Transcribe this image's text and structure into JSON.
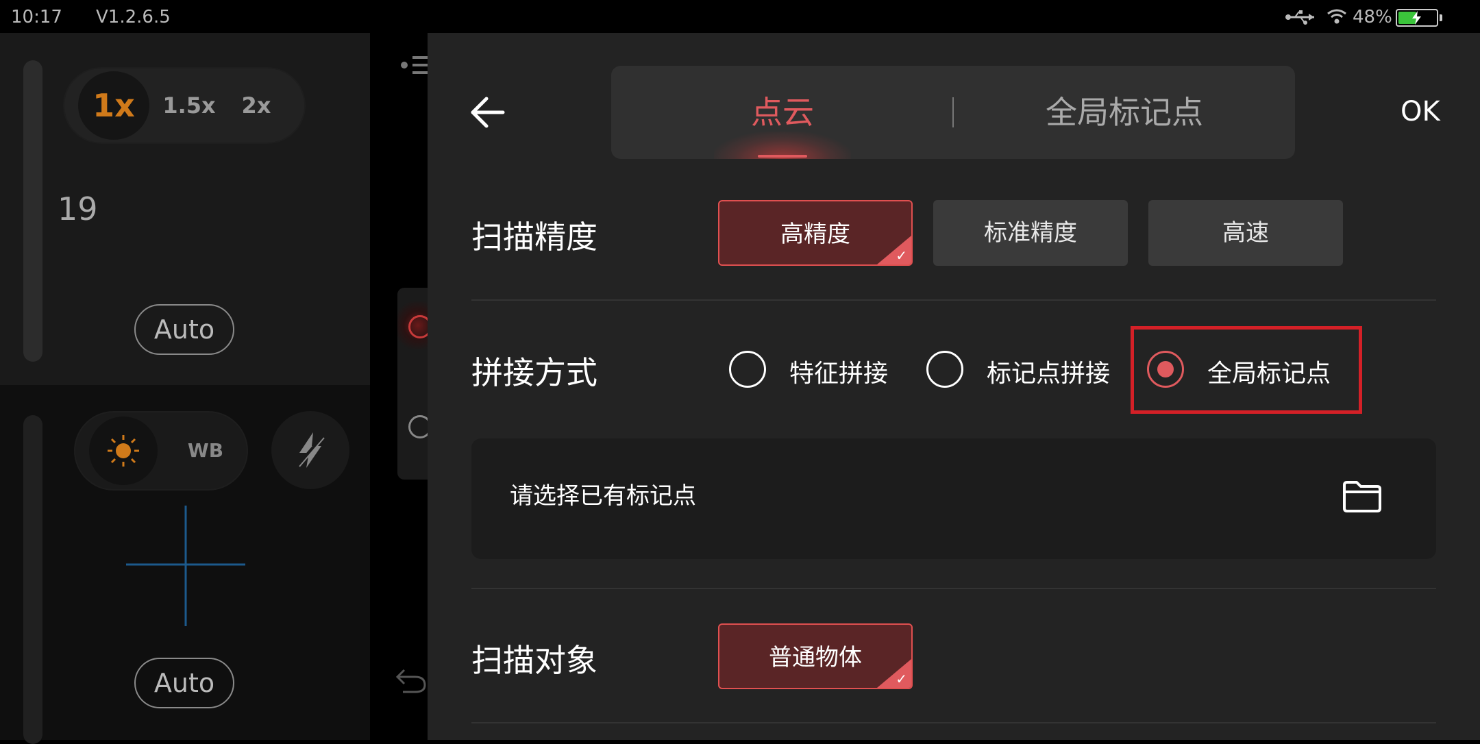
{
  "status_bar": {
    "time": "10:17",
    "version": "V1.2.6.5",
    "battery": "48%",
    "battery_level": 0.48
  },
  "camera_panel": {
    "zoom_options": [
      "1x",
      "1.5x",
      "2x"
    ],
    "zoom_selected": "1x",
    "value": "19",
    "auto_label_1": "Auto",
    "wb_label": "WB",
    "auto_label_2": "Auto",
    "accent_color": "#d07a1a"
  },
  "settings": {
    "back_icon": "arrow-left-icon",
    "ok_label": "OK",
    "tabs": [
      {
        "label": "点云",
        "active": true
      },
      {
        "label": "全局标记点",
        "active": false
      }
    ],
    "precision": {
      "label": "扫描精度",
      "options": [
        {
          "label": "高精度",
          "selected": true
        },
        {
          "label": "标准精度",
          "selected": false
        },
        {
          "label": "高速",
          "selected": false
        }
      ]
    },
    "stitching": {
      "label": "拼接方式",
      "options": [
        {
          "label": "特征拼接",
          "selected": false
        },
        {
          "label": "标记点拼接",
          "selected": false
        },
        {
          "label": "全局标记点",
          "selected": true
        }
      ]
    },
    "marker_file": {
      "placeholder": "请选择已有标记点",
      "icon": "folder-icon"
    },
    "scan_object": {
      "label": "扫描对象",
      "options": [
        {
          "label": "普通物体",
          "selected": true
        }
      ]
    },
    "accent_color": "#e05a5e",
    "highlight_color": "#d42027"
  }
}
